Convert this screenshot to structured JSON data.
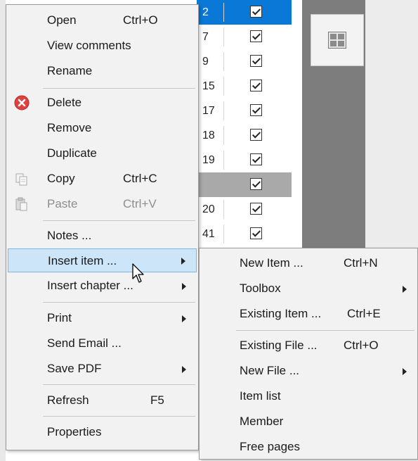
{
  "grid": {
    "rows": [
      {
        "num": "2",
        "checked": true,
        "state": "selected"
      },
      {
        "num": "7",
        "checked": true,
        "state": ""
      },
      {
        "num": "9",
        "checked": true,
        "state": ""
      },
      {
        "num": "15",
        "checked": true,
        "state": ""
      },
      {
        "num": "17",
        "checked": true,
        "state": ""
      },
      {
        "num": "18",
        "checked": true,
        "state": ""
      },
      {
        "num": "19",
        "checked": true,
        "state": ""
      },
      {
        "num": "",
        "checked": true,
        "state": "gray"
      },
      {
        "num": "20",
        "checked": true,
        "state": ""
      },
      {
        "num": "41",
        "checked": true,
        "state": ""
      }
    ]
  },
  "context_menu": {
    "open": {
      "label": "Open",
      "shortcut": "Ctrl+O"
    },
    "view_comments": {
      "label": "View comments"
    },
    "rename": {
      "label": "Rename"
    },
    "delete": {
      "label": "Delete"
    },
    "remove": {
      "label": "Remove"
    },
    "duplicate": {
      "label": "Duplicate"
    },
    "copy": {
      "label": "Copy",
      "shortcut": "Ctrl+C"
    },
    "paste": {
      "label": "Paste",
      "shortcut": "Ctrl+V"
    },
    "notes": {
      "label": "Notes ..."
    },
    "insert_item": {
      "label": "Insert item ..."
    },
    "insert_chapter": {
      "label": "Insert chapter ..."
    },
    "print": {
      "label": "Print"
    },
    "send_email": {
      "label": "Send Email ..."
    },
    "save_pdf": {
      "label": "Save PDF"
    },
    "refresh": {
      "label": "Refresh",
      "shortcut": "F5"
    },
    "properties": {
      "label": "Properties"
    }
  },
  "submenu": {
    "new_item": {
      "label": "New Item ...",
      "shortcut": "Ctrl+N"
    },
    "toolbox": {
      "label": "Toolbox"
    },
    "existing_item": {
      "label": "Existing Item ...",
      "shortcut": "Ctrl+E"
    },
    "existing_file": {
      "label": "Existing File ...",
      "shortcut": "Ctrl+O"
    },
    "new_file": {
      "label": "New File ..."
    },
    "item_list": {
      "label": "Item list"
    },
    "member": {
      "label": "Member"
    },
    "free_pages": {
      "label": "Free pages"
    }
  },
  "colors": {
    "selection_blue": "#0a78d7",
    "hover_fill": "#cde5f8",
    "hover_border": "#79b7e8",
    "delete_red": "#e04040"
  },
  "icons": [
    "delete-icon",
    "copy-icon",
    "paste-icon",
    "grid-view-icon",
    "submenu-arrow-icon",
    "mouse-cursor-icon"
  ]
}
